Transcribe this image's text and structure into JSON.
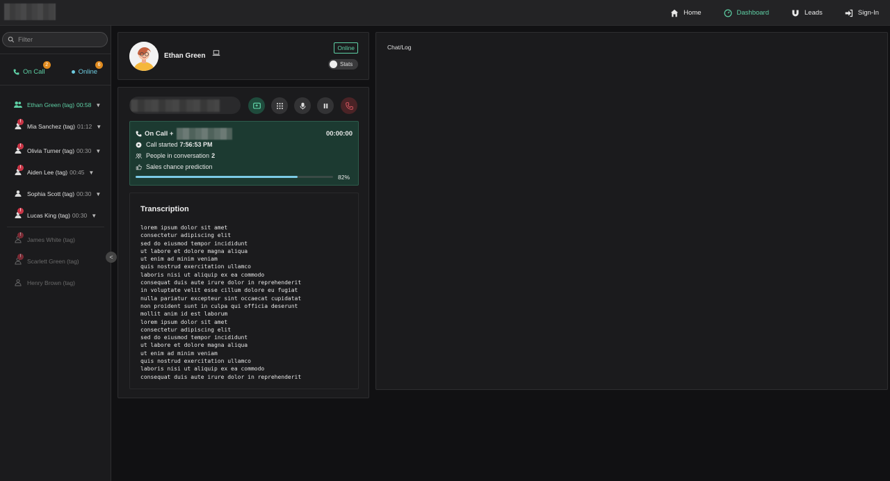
{
  "nav": {
    "items": [
      {
        "label": "Home",
        "icon": "home-icon"
      },
      {
        "label": "Dashboard",
        "icon": "dashboard-icon",
        "active": true
      },
      {
        "label": "Leads",
        "icon": "magnet-icon"
      },
      {
        "label": "Sign-In",
        "icon": "sign-in-icon"
      }
    ]
  },
  "sidebar": {
    "filter_placeholder": "Filter",
    "on_call": {
      "label": "On Call",
      "count": "2"
    },
    "online": {
      "label": "Online",
      "count": "6"
    },
    "contacts": [
      {
        "name": "Ethan Green (tag)",
        "time": "00:58",
        "state": "active"
      },
      {
        "name": "Mia Sanchez (tag)",
        "time": "01:12",
        "badge": "!"
      },
      {
        "name": "Olivia Turner (tag)",
        "time": "00:30",
        "badge": "!"
      },
      {
        "name": "Aiden Lee (tag)",
        "time": "00:45",
        "badge": "!"
      },
      {
        "name": "Sophia Scott (tag)",
        "time": "00:30"
      },
      {
        "name": "Lucas King (tag)",
        "time": "00:30",
        "badge": "!"
      },
      {
        "name": "James White (tag)",
        "state": "offline",
        "badge": "!"
      },
      {
        "name": "Scarlett Green (tag)",
        "state": "offline",
        "badge": "!"
      },
      {
        "name": "Henry Brown (tag)",
        "state": "offline"
      }
    ]
  },
  "profile": {
    "name": "Ethan Green",
    "status": "Online",
    "stats_label": "Stats"
  },
  "call": {
    "status_label": "On Call +",
    "timer": "00:00:00",
    "started_label": "Call started",
    "started_time": "7:56:53 PM",
    "people_label": "People in conversation",
    "people_count": "2",
    "prediction_label": "Sales chance prediction",
    "prediction_value": 0.82,
    "prediction_pct": "82%"
  },
  "transcription": {
    "title": "Transcription",
    "text": "lorem ipsum dolor sit amet\nconsectetur adipiscing elit\nsed do eiusmod tempor incididunt\nut labore et dolore magna aliqua\nut enim ad minim veniam\nquis nostrud exercitation ullamco\nlaboris nisi ut aliquip ex ea commodo\nconsequat duis aute irure dolor in reprehenderit\nin voluptate velit esse cillum dolore eu fugiat\nnulla pariatur excepteur sint occaecat cupidatat\nnon proident sunt in culpa qui officia deserunt\nmollit anim id est laborum\nlorem ipsum dolor sit amet\nconsectetur adipiscing elit\nsed do eiusmod tempor incididunt\nut labore et dolore magna aliqua\nut enim ad minim veniam\nquis nostrud exercitation ullamco\nlaboris nisi ut aliquip ex ea commodo\nconsequat duis aute irure dolor in reprehenderit"
  },
  "chat": {
    "title": "Chat/Log"
  },
  "colors": {
    "accent": "#5fd1a6",
    "online": "#6ecbe0",
    "badge": "#e08a1e",
    "alert": "#c93546",
    "progress": "#7ccbe6"
  }
}
